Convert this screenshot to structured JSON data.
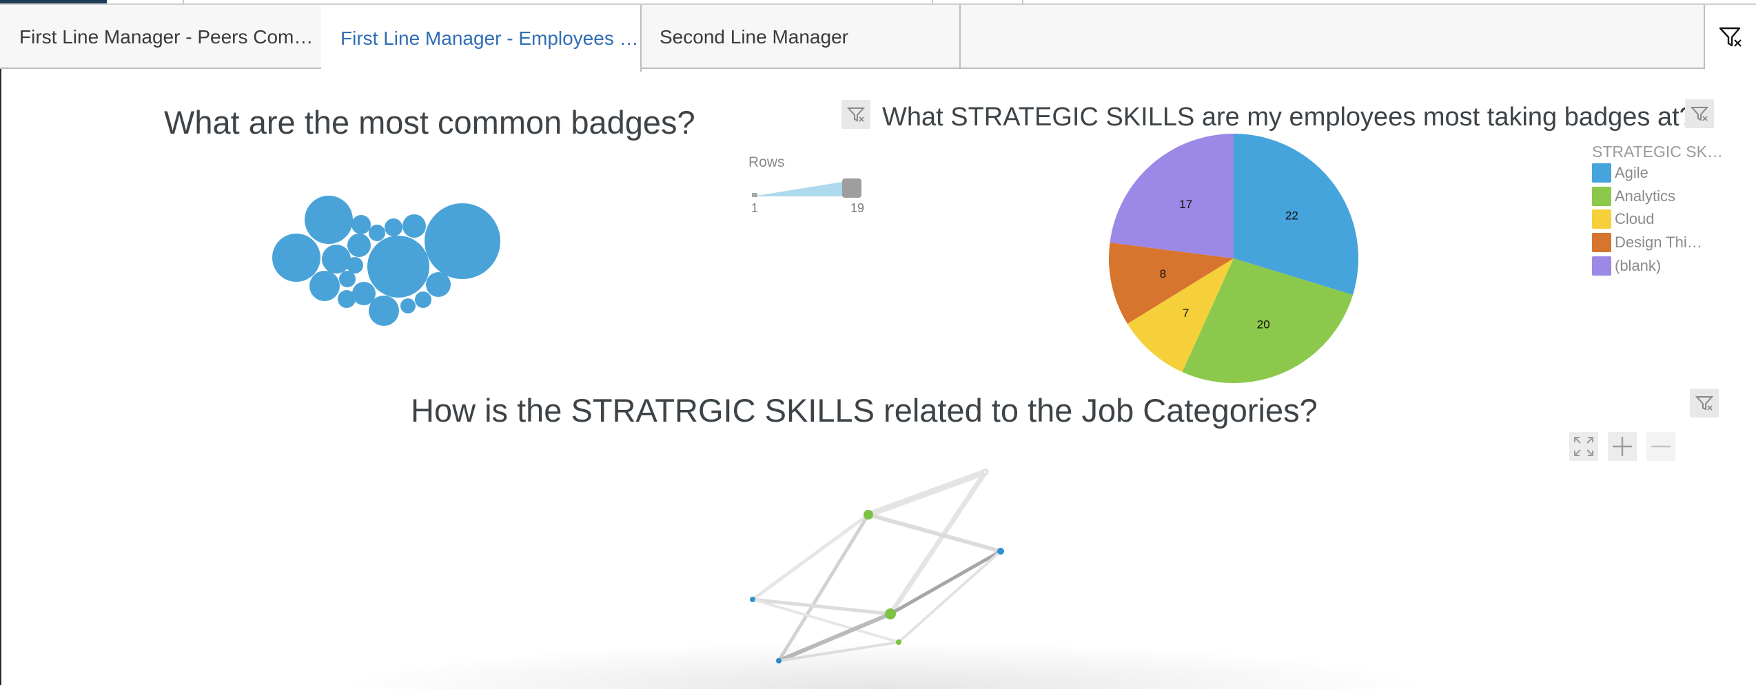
{
  "tabs": [
    {
      "label": "First Line Manager - Peers Com…",
      "active": false
    },
    {
      "label": "First Line Manager - Employees …",
      "active": true
    },
    {
      "label": "Second Line Manager",
      "active": false
    }
  ],
  "icons": {
    "filter": "filter-icon",
    "expand": "expand-icon",
    "zoom_in": "plus-icon",
    "zoom_out": "minus-icon"
  },
  "badges_viz": {
    "title": "What are the most common badges?",
    "bubble_color": "#4aa3d8",
    "rows_filter": {
      "label": "Rows",
      "min": "1",
      "max": "19"
    }
  },
  "skills_viz": {
    "title": "What STRATEGIC SKILLS are my employees most taking badges at?",
    "legend_title": "STRATEGIC SK…",
    "legend": [
      {
        "label": "Agile",
        "color": "#46a4dc"
      },
      {
        "label": "Analytics",
        "color": "#8cc84b"
      },
      {
        "label": "Cloud",
        "color": "#f5d03a"
      },
      {
        "label": "Design Thi…",
        "color": "#d7742e"
      },
      {
        "label": "(blank)",
        "color": "#9c88e6"
      }
    ]
  },
  "chart_data": {
    "type": "pie",
    "categories": [
      "Agile",
      "Analytics",
      "Cloud",
      "Design Thi…",
      "(blank)"
    ],
    "values": [
      22,
      20,
      7,
      8,
      17
    ],
    "colors": [
      "#46a4dc",
      "#8cc84b",
      "#f5d03a",
      "#d7742e",
      "#9c88e6"
    ],
    "legend_position": "right"
  },
  "relation_viz": {
    "title": "How is the STRATRGIC SKILLS related to the Job Categories?"
  }
}
